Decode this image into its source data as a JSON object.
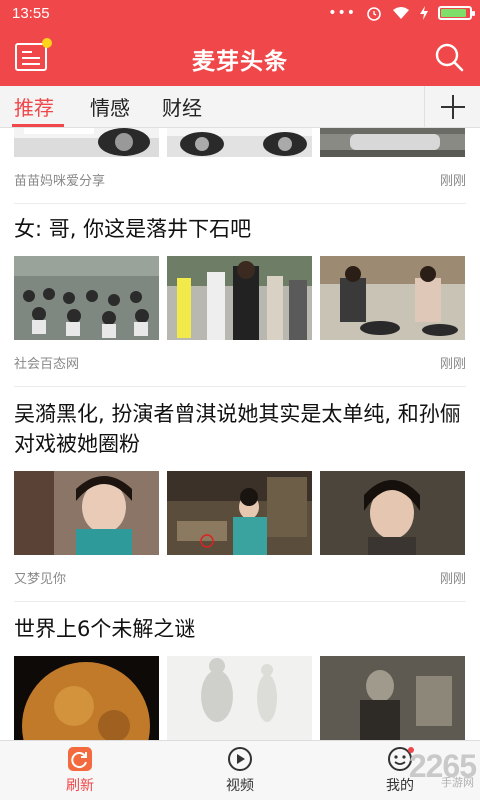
{
  "status_bar": {
    "time": "13:55",
    "battery_level": 0.9
  },
  "header": {
    "title": "麦芽头条"
  },
  "tabs": [
    {
      "label": "推荐",
      "active": true
    },
    {
      "label": "情感",
      "active": false
    },
    {
      "label": "财经",
      "active": false
    }
  ],
  "feed": {
    "articles": [
      {
        "title": "",
        "source": "苗苗妈咪爱分享",
        "time": "刚刚",
        "images": [
          "car-photo",
          "car-photo",
          "street-car-photo"
        ]
      },
      {
        "title": "女: 哥, 你这是落井下石吧",
        "source": "社会百态网",
        "time": "刚刚",
        "images": [
          "crowd-photo",
          "street-people-photo",
          "cooking-woman-photo"
        ]
      },
      {
        "title": "吴漪黑化, 扮演者曾淇说她其实是太单纯, 和孙俪对戏被她圈粉",
        "source": "又梦见你",
        "time": "刚刚",
        "images": [
          "drama-actress-photo",
          "drama-scene-photo",
          "drama-closeup-photo"
        ]
      },
      {
        "title": "世界上6个未解之谜",
        "source": "",
        "time": "",
        "images": [
          "planet-photo",
          "figure-sketch-photo",
          "vintage-photo"
        ]
      }
    ]
  },
  "bottom_nav": [
    {
      "label": "刷新",
      "icon": "refresh-icon",
      "active": true
    },
    {
      "label": "视频",
      "icon": "video-icon",
      "active": false
    },
    {
      "label": "我的",
      "icon": "user-icon",
      "active": false
    }
  ],
  "watermark": {
    "text": "2265",
    "sub": "手游网"
  },
  "colors": {
    "brand": "#f0484a",
    "text": "#111111",
    "meta": "#888888"
  }
}
